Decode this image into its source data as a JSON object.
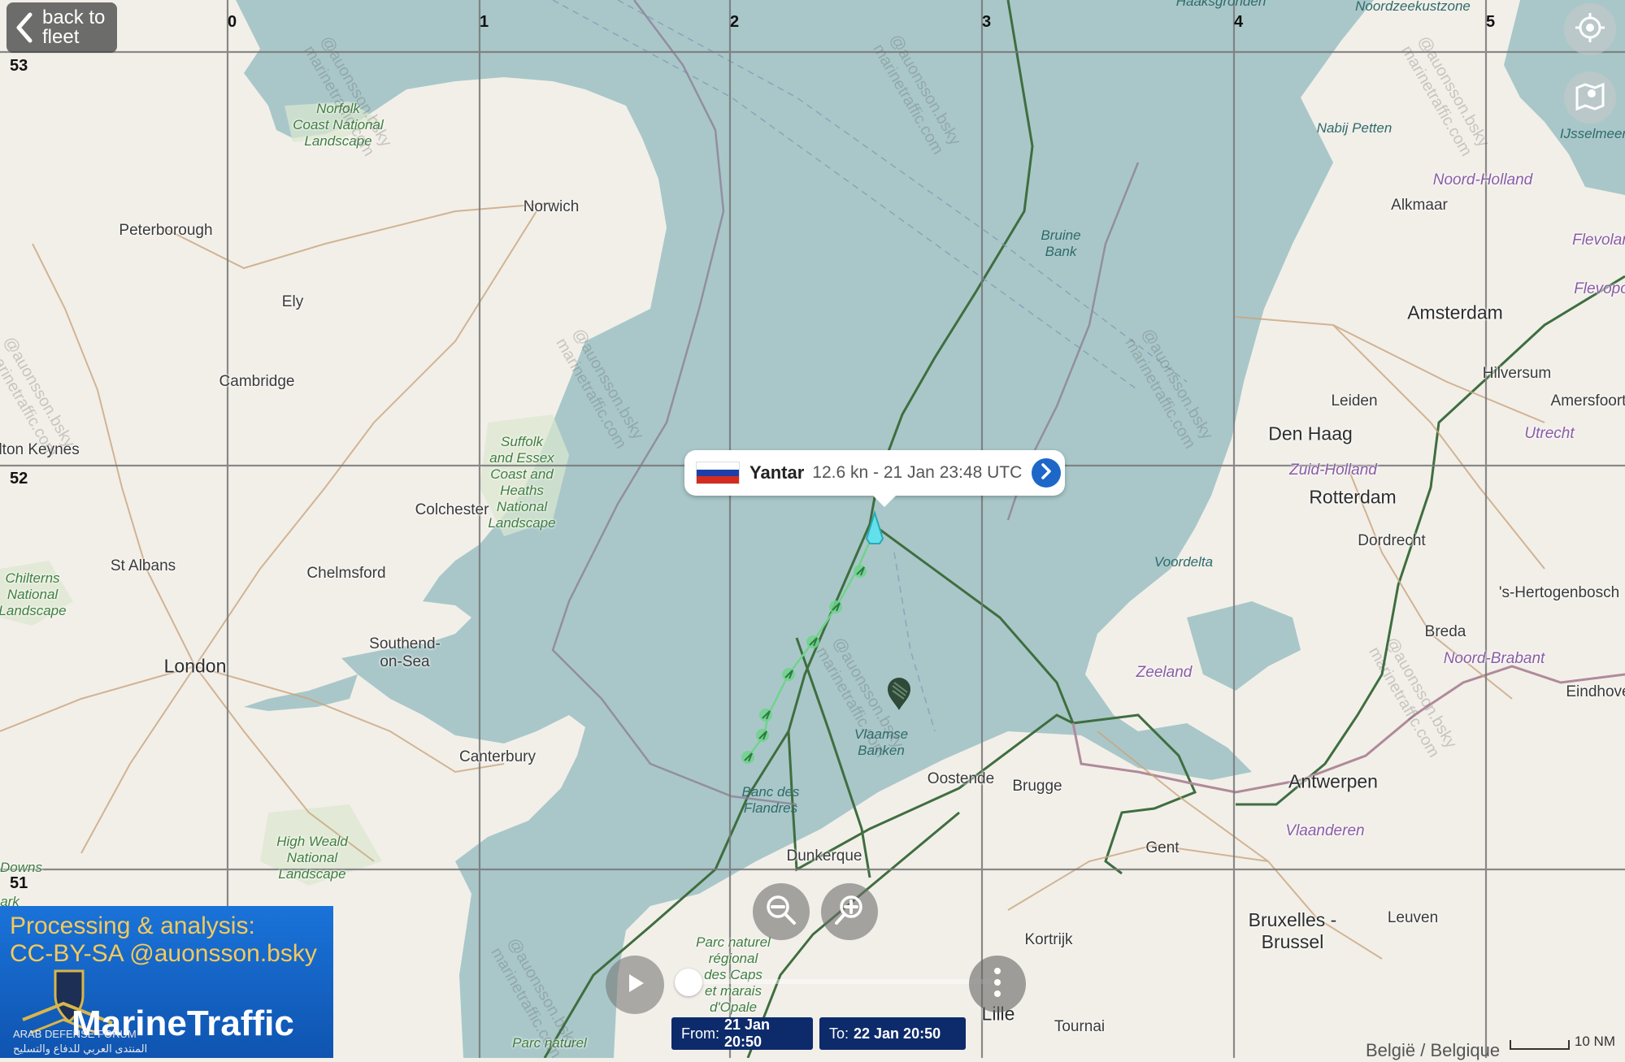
{
  "nav": {
    "back_label": "back to\nfleet"
  },
  "grid": {
    "lon_labels": [
      "0",
      "1",
      "2",
      "3",
      "4",
      "5"
    ],
    "lat_labels": [
      "53",
      "52",
      "51"
    ]
  },
  "places": {
    "peterborough": "Peterborough",
    "norwich": "Norwich",
    "ely": "Ely",
    "cambridge": "Cambridge",
    "milton_keynes": "ilton Keynes",
    "colchester": "Colchester",
    "st_albans": "St Albans",
    "chelmsford": "Chelmsford",
    "london": "London",
    "southend": "Southend-\non-Sea",
    "canterbury": "Canterbury",
    "dunkerque": "Dunkerque",
    "oostende": "Oostende",
    "brugge": "Brugge",
    "gent": "Gent",
    "antwerpen": "Antwerpen",
    "kortrijk": "Kortrijk",
    "lille": "Lille",
    "tournai": "Tournai",
    "bruxelles": "Bruxelles -\nBrussel",
    "leuven": "Leuven",
    "rotterdam": "Rotterdam",
    "den_haag": "Den Haag",
    "leiden": "Leiden",
    "amsterdam": "Amsterdam",
    "alkmaar": "Alkmaar",
    "hilversum": "Hilversum",
    "amersfoort": "Amersfoort",
    "dordrecht": "Dordrecht",
    "breda": "Breda",
    "hertogenbosch": "'s-Hertogenbosch",
    "eindhoven": "Eindhove",
    "norfolk_coast": "Norfolk\nCoast National\nLandscape",
    "suffolk": "Suffolk\nand Essex\nCoast and\nHeaths\nNational\nLandscape",
    "chilterns": "Chilterns\nNational\nLandscape",
    "high_weald": "High Weald\nNational\nLandscape",
    "parc_caps": "Parc naturel\nrégional\ndes Caps\net marais\nd'Opale",
    "parc_naturel": "Parc naturel",
    "bruine_bank": "Bruine\nBank",
    "vlaamse_banken": "Vlaamse\nBanken",
    "banc_flandres": "Banc des\nFlandres",
    "voordelta": "Voordelta",
    "nabij_petten": "Nabij Petten",
    "noordzeekustzone": "Noordzeekustzone",
    "haaksgronden": "Haaksgronden",
    "ijsselmeer": "IJsselmeer",
    "flevoland": "Flevolan",
    "flevopolder": "Flevopo",
    "zeeland": "Zeeland",
    "noord_holland": "Noord-Holland",
    "zuid_holland": "Zuid-Holland",
    "utrecht": "Utrecht",
    "noord_brabant": "Noord-Brabant",
    "vlaanderen": "Vlaanderen",
    "downs": "Downs",
    "ark": "ark"
  },
  "watermark": "@auonsson.bsky\nmarinetraffic.com",
  "vessel": {
    "name": "Yantar",
    "info": "12.6 kn - 21 Jan 23:48 UTC",
    "flag_colors": [
      "#ffffff",
      "#1c3fa8",
      "#d52b1e"
    ]
  },
  "playback": {
    "from_label": "From:",
    "from_value": "21 Jan 20:50",
    "to_label": "To:",
    "to_value": "22 Jan 20:50"
  },
  "credit": {
    "text": "Processing & analysis:\nCC-BY-SA @auonsson.bsky",
    "brand": "MarineTraffic",
    "arab_label": "ARAB DEFENSE FORUM",
    "arab_subtitle": "المنتدى العربي للدفاع والتسليح"
  },
  "scale": {
    "label": "10 NM"
  },
  "country_label": "België / Belgique",
  "colors": {
    "sea": "#a9c7c9",
    "land": "#f2efe9",
    "track": "#6fd48a",
    "vessel": "#62e0ec",
    "border": "#3f6e3f",
    "grid": "#777777",
    "range_bg": "#0d2b6b",
    "credit_bg": "#1a73d9"
  },
  "icons": {
    "back": "chevron-left-icon",
    "locate": "crosshair-icon",
    "layers": "map-layers-icon",
    "zoom_out": "zoom-out-icon",
    "zoom_in": "zoom-in-icon",
    "play": "play-icon",
    "more": "more-vertical-icon",
    "details": "chevron-right-icon",
    "waypoint": "map-pin-icon"
  }
}
